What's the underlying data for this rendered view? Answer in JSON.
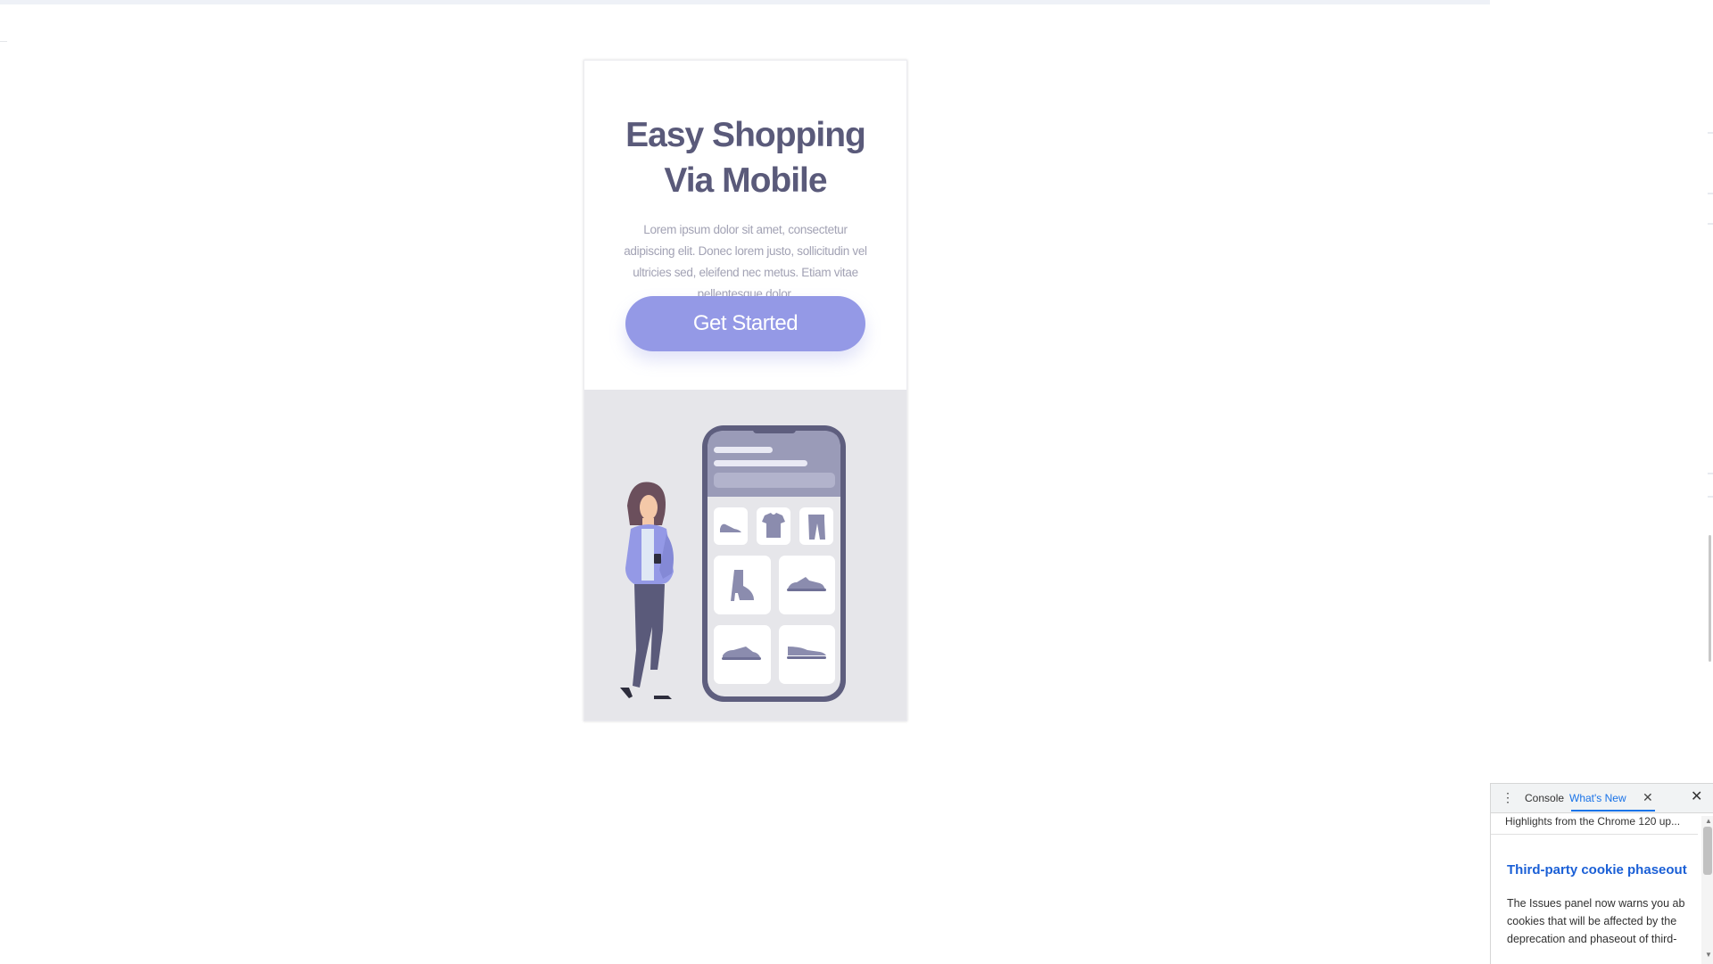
{
  "hero": {
    "headline": "Easy Shopping Via Mobile",
    "body": "Lorem ipsum dolor sit amet, consectetur adipiscing elit. Donec lorem justo, sollicitudin vel ultricies sed, eleifend nec metus. Etiam vitae pellentesque dolor.",
    "cta_label": "Get Started"
  },
  "colors": {
    "headline": "#5a5a7a",
    "body_text": "#a2a2b4",
    "cta_background": "#9499e6",
    "illustration_background": "#e6e6ea",
    "phone_frame": "#5e5e7e",
    "devtools_accent": "#1a73e8"
  },
  "illustration": {
    "product_icons": [
      "flat-shoe-icon",
      "t-shirt-icon",
      "pants-icon",
      "boot-icon",
      "sneaker-icon",
      "sneaker-icon",
      "sneaker-icon"
    ]
  },
  "devtools": {
    "menu_icon": "kebab-menu-icon",
    "tabs": [
      {
        "label": "Console"
      },
      {
        "label": "What's New"
      }
    ],
    "close_icon": "close-icon",
    "subtitle": "Highlights from the Chrome 120 up...",
    "article_title": "Third-party cookie phaseout",
    "article_lines": [
      "The Issues panel now warns you ab",
      "cookies that will be affected by the",
      "deprecation and phaseout of third-"
    ]
  }
}
